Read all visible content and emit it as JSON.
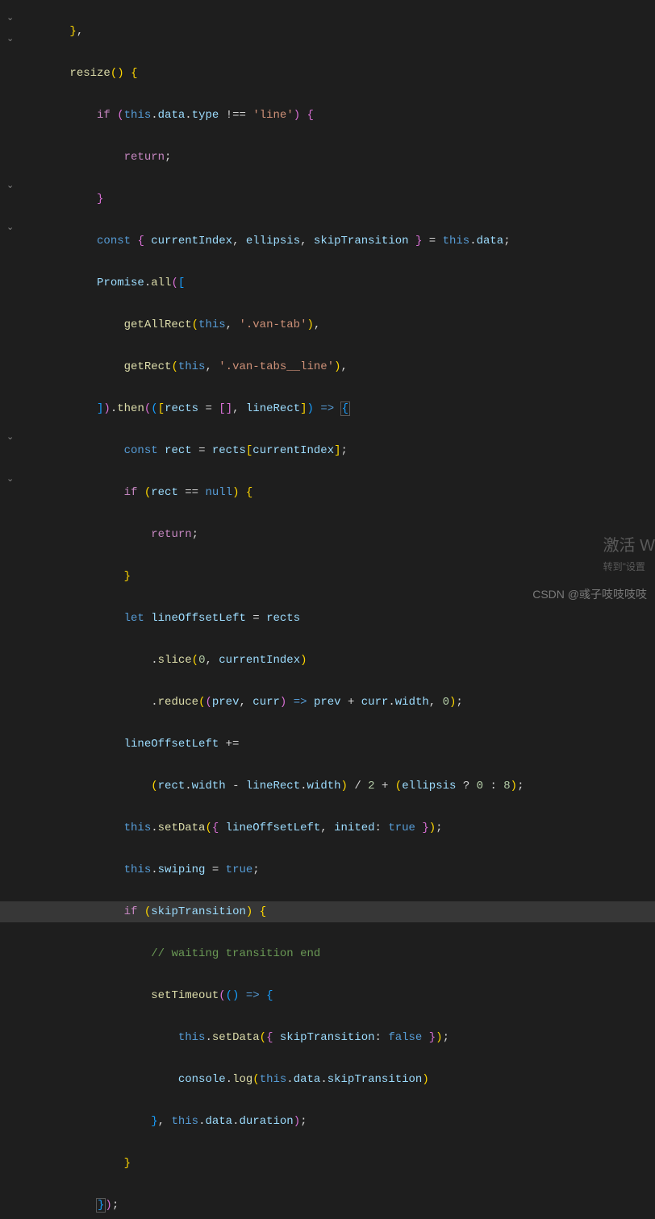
{
  "code": {
    "fn_resize": "resize",
    "kw_if": "if",
    "kw_return": "return",
    "kw_const": "const",
    "kw_let": "let",
    "kw_this": "this",
    "kw_null": "null",
    "kw_true": "true",
    "kw_false": "false",
    "prop_data": "data",
    "prop_type": "type",
    "str_line": "'line'",
    "var_currentIndex": "currentIndex",
    "var_ellipsis": "ellipsis",
    "var_skipTransition": "skipTransition",
    "cls_Promise": "Promise",
    "method_all": "all",
    "fn_getAllRect": "getAllRect",
    "fn_getRect": "getRect",
    "str_vantab": "'.van-tab'",
    "str_vantabsline": "'.van-tabs__line'",
    "method_then": "then",
    "var_rects": "rects",
    "var_lineRect": "lineRect",
    "var_rect": "rect",
    "var_lineOffsetLeft": "lineOffsetLeft",
    "method_slice": "slice",
    "method_reduce": "reduce",
    "var_prev": "prev",
    "var_curr": "curr",
    "prop_width": "width",
    "method_setData": "setData",
    "var_inited": "inited",
    "prop_swiping": "swiping",
    "comment_wait": "// waiting transition end",
    "fn_setTimeout": "setTimeout",
    "obj_console": "console",
    "method_log": "log",
    "prop_duration": "duration",
    "num_0": "0",
    "num_2": "2",
    "num_8": "8"
  },
  "watermark": {
    "title": "激活 W",
    "subtitle": "转到\"设置"
  },
  "csdn": "CSDN @彧子吱吱吱吱"
}
